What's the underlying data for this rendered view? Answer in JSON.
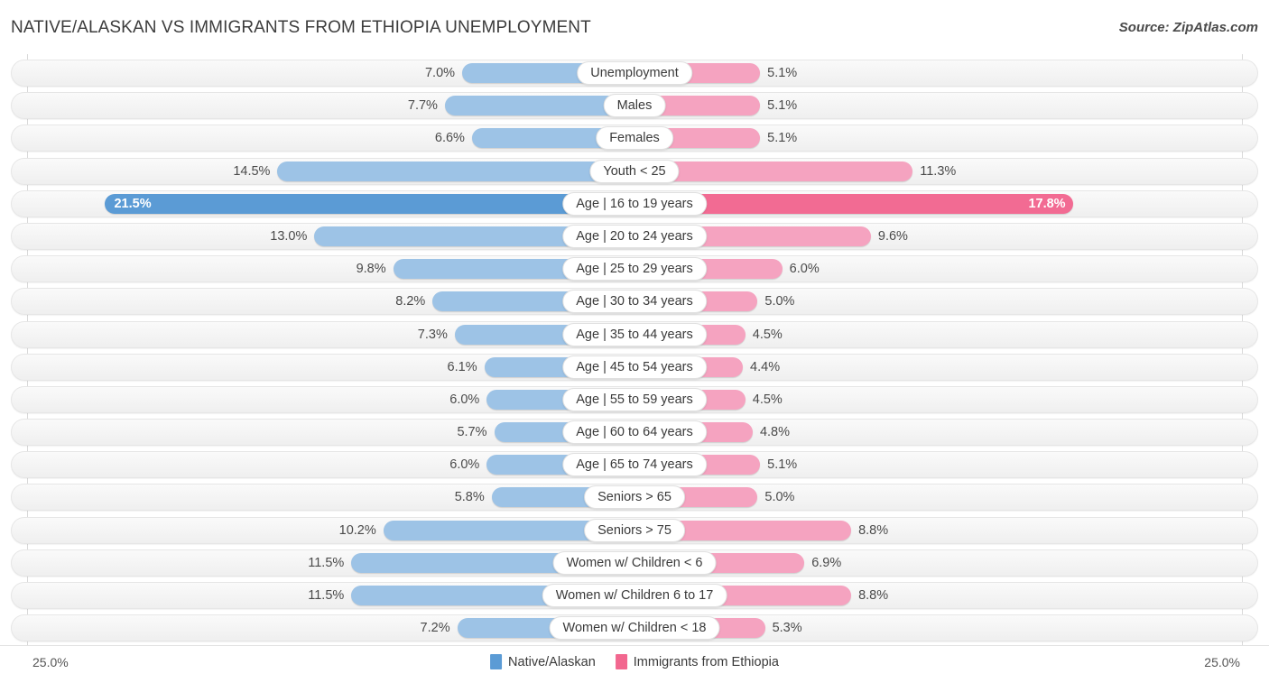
{
  "header": {
    "title": "NATIVE/ALASKAN VS IMMIGRANTS FROM ETHIOPIA UNEMPLOYMENT",
    "source": "Source: ZipAtlas.com"
  },
  "footer": {
    "axis_min_left": "25.0%",
    "axis_min_right": "25.0%",
    "legend": [
      {
        "label": "Native/Alaskan",
        "color": "#5b9bd5"
      },
      {
        "label": "Immigrants from Ethiopia",
        "color": "#f2678f"
      }
    ]
  },
  "chart_data": {
    "type": "bar",
    "title": "NATIVE/ALASKAN VS IMMIGRANTS FROM ETHIOPIA UNEMPLOYMENT",
    "subtitle": "",
    "xlabel": "",
    "ylabel": "",
    "orientation": "horizontal-diverging",
    "grid": false,
    "legend_position": "bottom-center",
    "axis_max": 25.0,
    "axis_unit": "%",
    "xlim": [
      25.0,
      25.0
    ],
    "categories": [
      "Unemployment",
      "Males",
      "Females",
      "Youth < 25",
      "Age | 16 to 19 years",
      "Age | 20 to 24 years",
      "Age | 25 to 29 years",
      "Age | 30 to 34 years",
      "Age | 35 to 44 years",
      "Age | 45 to 54 years",
      "Age | 55 to 59 years",
      "Age | 60 to 64 years",
      "Age | 65 to 74 years",
      "Seniors > 65",
      "Seniors > 75",
      "Women w/ Children < 6",
      "Women w/ Children 6 to 17",
      "Women w/ Children < 18"
    ],
    "series": [
      {
        "name": "Native/Alaskan",
        "color": "#9dc3e6",
        "highlight_color": "#5b9bd5",
        "side": "left",
        "values": [
          7.0,
          7.7,
          6.6,
          14.5,
          21.5,
          13.0,
          9.8,
          8.2,
          7.3,
          6.1,
          6.0,
          5.7,
          6.0,
          5.8,
          10.2,
          11.5,
          11.5,
          7.2
        ],
        "labels": [
          "7.0%",
          "7.7%",
          "6.6%",
          "14.5%",
          "21.5%",
          "13.0%",
          "9.8%",
          "8.2%",
          "7.3%",
          "6.1%",
          "6.0%",
          "5.7%",
          "6.0%",
          "5.8%",
          "10.2%",
          "11.5%",
          "11.5%",
          "7.2%"
        ]
      },
      {
        "name": "Immigrants from Ethiopia",
        "color": "#f5a3c0",
        "highlight_color": "#f26b93",
        "side": "right",
        "values": [
          5.1,
          5.1,
          5.1,
          11.3,
          17.8,
          9.6,
          6.0,
          5.0,
          4.5,
          4.4,
          4.5,
          4.8,
          5.1,
          5.0,
          8.8,
          6.9,
          8.8,
          5.3
        ],
        "labels": [
          "5.1%",
          "5.1%",
          "5.1%",
          "11.3%",
          "17.8%",
          "9.6%",
          "6.0%",
          "5.0%",
          "4.5%",
          "4.4%",
          "4.5%",
          "4.8%",
          "5.1%",
          "5.0%",
          "8.8%",
          "6.9%",
          "8.8%",
          "5.3%"
        ]
      }
    ],
    "highlighted_row_index": 4
  }
}
